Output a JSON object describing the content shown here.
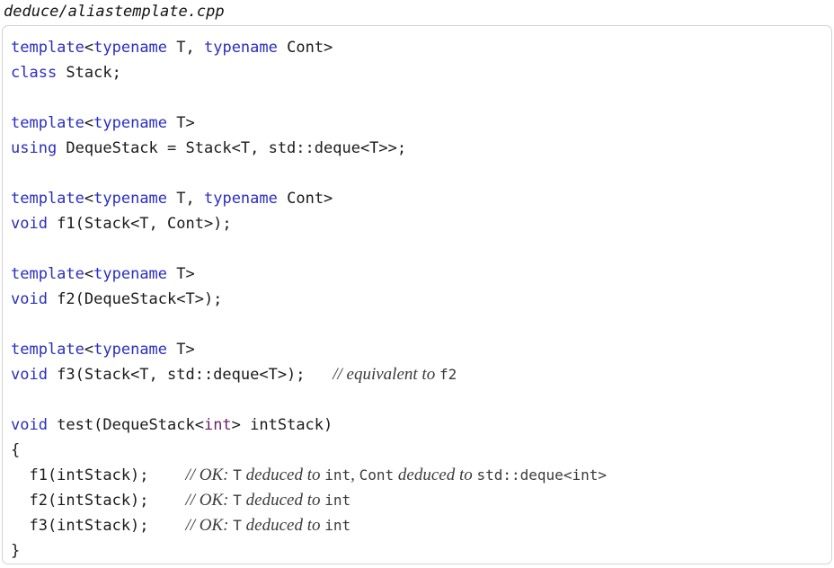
{
  "file_caption": "deduce/aliastemplate.cpp",
  "code": {
    "l1_kw1": "template",
    "l1_p1": "<",
    "l1_kw2": "typename",
    "l1_p2": " T, ",
    "l1_kw3": "typename",
    "l1_p3": " Cont>",
    "l2_kw": "class",
    "l2_p": " Stack;",
    "l4_kw1": "template",
    "l4_p1": "<",
    "l4_kw2": "typename",
    "l4_p2": " T>",
    "l5_kw": "using",
    "l5_p": " DequeStack = Stack<T, std::deque<T>>;",
    "l7_kw1": "template",
    "l7_p1": "<",
    "l7_kw2": "typename",
    "l7_p2": " T, ",
    "l7_kw3": "typename",
    "l7_p3": " Cont>",
    "l8_kw": "void",
    "l8_p": " f1(Stack<T, Cont>);",
    "l10_kw1": "template",
    "l10_p1": "<",
    "l10_kw2": "typename",
    "l10_p2": " T>",
    "l11_kw": "void",
    "l11_p": " f2(DequeStack<T>);",
    "l13_kw1": "template",
    "l13_p1": "<",
    "l13_kw2": "typename",
    "l13_p2": " T>",
    "l14_kw": "void",
    "l14_p": " f3(Stack<T, std::deque<T>);   ",
    "l14_cm1": "// equivalent to ",
    "l14_cm_tt1": "f2",
    "l16_kw": "void",
    "l16_p1": " test(DequeStack<",
    "l16_type": "int",
    "l16_p2": "> intStack)",
    "l17_p": "{",
    "l18_p": "  f1(intStack);    ",
    "l18_cm1": "// OK: ",
    "l18_tt1": "T",
    "l18_cm2": " deduced to ",
    "l18_tt2": "int",
    "l18_cm3": ", ",
    "l18_tt3": "Cont",
    "l18_cm4": " deduced to ",
    "l18_tt4": "std::deque<int>",
    "l19_p": "  f2(intStack);    ",
    "l19_cm1": "// OK: ",
    "l19_tt1": "T",
    "l19_cm2": " deduced to ",
    "l19_tt2": "int",
    "l20_p": "  f3(intStack);    ",
    "l20_cm1": "// OK: ",
    "l20_tt1": "T",
    "l20_cm2": " deduced to ",
    "l20_tt2": "int",
    "l21_p": "}"
  }
}
